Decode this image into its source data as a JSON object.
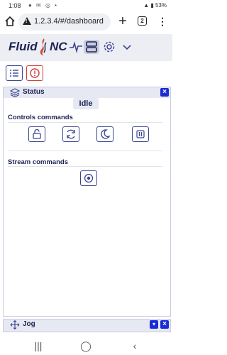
{
  "statusbar": {
    "time": "1:08",
    "battery": "53%"
  },
  "browser": {
    "url": "1.2.3.4/#/dashboard",
    "tab_count": "2"
  },
  "app": {
    "brand_left": "Fluid",
    "brand_right": "NC",
    "accent": "#1a2bd8",
    "brand_color": "#1d2355"
  },
  "status_panel": {
    "title": "Status",
    "close_label": "×",
    "state": "Idle",
    "controls_title": "Controls commands",
    "stream_title": "Stream commands"
  },
  "jog_panel": {
    "title": "Jog",
    "collapse_label": "▾",
    "close_label": "×"
  },
  "icons": {
    "header": [
      "pulse-icon",
      "dashboard-icon",
      "gear-icon",
      "chevron-down-icon"
    ],
    "controls": [
      "unlock-icon",
      "refresh-icon",
      "sleep-icon",
      "pause-icon"
    ],
    "stream": [
      "record-icon"
    ]
  }
}
